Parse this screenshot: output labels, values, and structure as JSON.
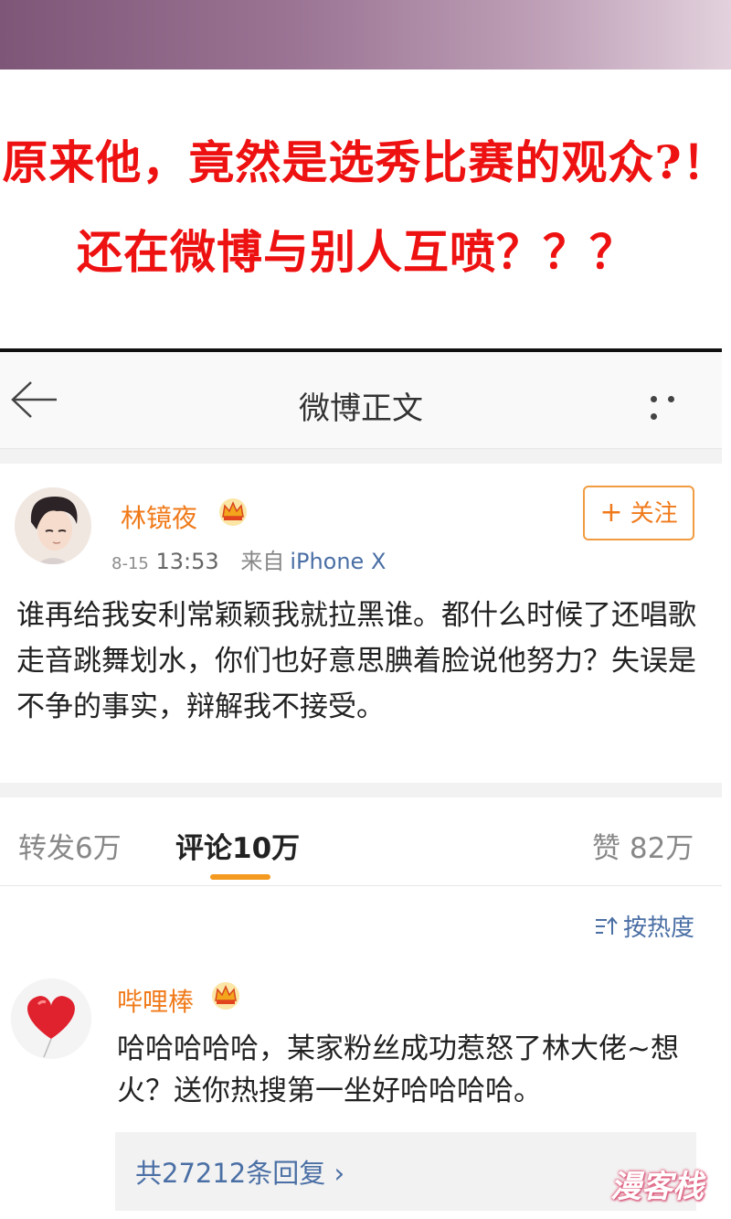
{
  "caption": {
    "line1": "原来他，竟然是选秀比赛的观众?！",
    "line2": "还在微博与别人互喷？？？"
  },
  "nav": {
    "title": "微博正文",
    "back_icon": "back-arrow-icon",
    "more_icon": "more-dots-icon"
  },
  "post": {
    "username": "林镜夜",
    "badge_icon": "crown-icon",
    "follow_label": "关注",
    "follow_plus": "+",
    "date": "8-15",
    "time": "13:53",
    "from_label": "来自",
    "source": "iPhone X",
    "text": "谁再给我安利常颖颖我就拉黑谁。都什么时候了还唱歌走音跳舞划水，你们也好意思腆着脸说他努力？失误是不争的事实，辩解我不接受。"
  },
  "tabs": {
    "repost": "转发6万",
    "comment": "评论10万",
    "like": "赞 82万"
  },
  "sort": {
    "label": "按热度",
    "icon": "sort-icon"
  },
  "comment": {
    "username": "哔哩棒",
    "badge_icon": "crown-icon",
    "avatar_icon": "heart-balloon-icon",
    "text": "哈哈哈哈哈，某家粉丝成功惹怒了林大佬~想火？送你热搜第一坐好哈哈哈哈。",
    "replies": "共27212条回复 ›"
  },
  "watermark": "漫客栈",
  "colors": {
    "caption": "#ee1111",
    "orange": "#f07a1a",
    "link": "#4a6fa5",
    "tab_underline": "#f49a20"
  }
}
